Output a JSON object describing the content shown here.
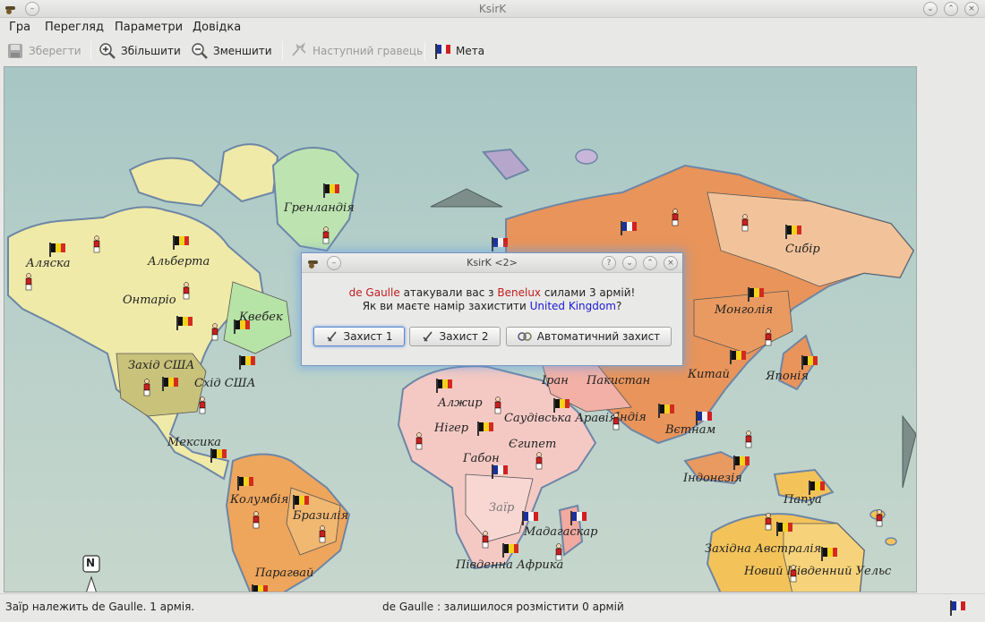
{
  "window": {
    "title": "KsirK"
  },
  "menubar": {
    "items": [
      {
        "label": "Гра"
      },
      {
        "label": "Перегляд"
      },
      {
        "label": "Параметри"
      },
      {
        "label": "Довідка"
      }
    ]
  },
  "toolbar": {
    "save_label": "Зберегти",
    "zoom_in_label": "Збільшити",
    "zoom_out_label": "Зменшити",
    "next_player_label": "Наступний гравець",
    "goal_label": "Мета"
  },
  "map": {
    "territories": [
      {
        "name": "Аляска"
      },
      {
        "name": "Альберта"
      },
      {
        "name": "Гренландія"
      },
      {
        "name": "Онтаріо"
      },
      {
        "name": "Квебек"
      },
      {
        "name": "Захід США"
      },
      {
        "name": "Схід США"
      },
      {
        "name": "Мексика"
      },
      {
        "name": "Колумбія"
      },
      {
        "name": "Бразилія"
      },
      {
        "name": "Парагвай"
      },
      {
        "name": "Алжир"
      },
      {
        "name": "Нігер"
      },
      {
        "name": "Габон"
      },
      {
        "name": "Заїр"
      },
      {
        "name": "Південна Африка"
      },
      {
        "name": "Мадагаскар"
      },
      {
        "name": "Єгипет"
      },
      {
        "name": "Саудівська Аравія"
      },
      {
        "name": "Іран"
      },
      {
        "name": "Пакистан"
      },
      {
        "name": "Індія"
      },
      {
        "name": "Китай"
      },
      {
        "name": "Монголія"
      },
      {
        "name": "Сибір"
      },
      {
        "name": "Японія"
      },
      {
        "name": "Вєтнам"
      },
      {
        "name": "Індонезія"
      },
      {
        "name": "Папуа"
      },
      {
        "name": "Західна Австралія"
      },
      {
        "name": "Новий Південний Уельс"
      }
    ],
    "compass": "N",
    "colors": {
      "ocean": "#b2ccc7",
      "north_america": "#efeaa8",
      "south_america": "#eea55c",
      "africa": "#f4c9c4",
      "asia": "#e8945b",
      "oceania": "#f3c35a",
      "greenland": "#bde3b0"
    }
  },
  "dialog": {
    "title": "KsirK <2>",
    "attacker": "de Gaulle",
    "text_attacked": "атакували вас з",
    "from_country": "Benelux",
    "text_forces": "силами 3 армій!",
    "question_prefix": "Як ви маєте намір захистити",
    "target_country": "United Kingdom",
    "question_suffix": "?",
    "buttons": {
      "defend1": "Захист 1",
      "defend2": "Захист 2",
      "auto_defend": "Автоматичний захист"
    }
  },
  "statusbar": {
    "left": "Заїр належить de Gaulle. 1 армія.",
    "center": "de Gaulle : залишилося розмістити 0 армій"
  }
}
